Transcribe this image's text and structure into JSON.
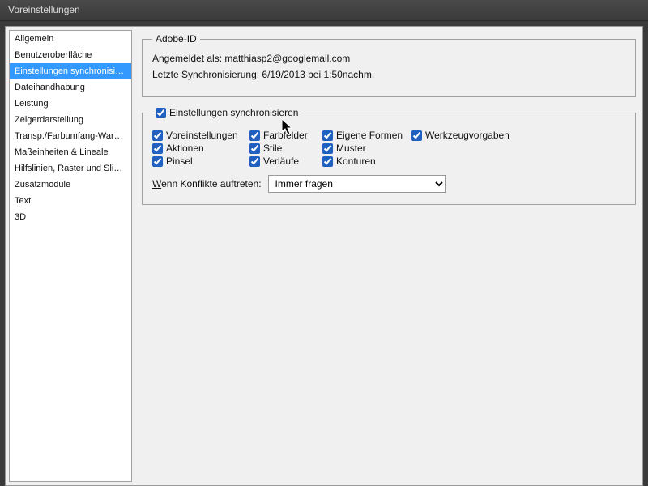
{
  "window": {
    "title": "Voreinstellungen"
  },
  "sidebar": {
    "items": [
      {
        "label": "Allgemein"
      },
      {
        "label": "Benutzeroberfläche"
      },
      {
        "label": "Einstellungen synchronisieren",
        "selected": true
      },
      {
        "label": "Dateihandhabung"
      },
      {
        "label": "Leistung"
      },
      {
        "label": "Zeigerdarstellung"
      },
      {
        "label": "Transp./Farbumfang-Warnung"
      },
      {
        "label": "Maßeinheiten & Lineale"
      },
      {
        "label": "Hilfslinien, Raster und Slices"
      },
      {
        "label": "Zusatzmodule"
      },
      {
        "label": "Text"
      },
      {
        "label": "3D"
      }
    ]
  },
  "adobe_id": {
    "legend": "Adobe-ID",
    "signed_in": "Angemeldet als: matthiasp2@googlemail.com",
    "last_sync": "Letzte Synchronisierung: 6/19/2013 bei 1:50nachm."
  },
  "sync": {
    "master": "Einstellungen synchronisieren",
    "options": {
      "preferences": "Voreinstellungen",
      "swatches": "Farbfelder",
      "shapes": "Eigene Formen",
      "tool_presets": "Werkzeugvorgaben",
      "actions": "Aktionen",
      "styles": "Stile",
      "patterns": "Muster",
      "brushes": "Pinsel",
      "gradients": "Verläufe",
      "contours": "Konturen"
    },
    "conflict_label_prefix": "W",
    "conflict_label_rest": "enn Konflikte auftreten:",
    "conflict_selected": "Immer fragen"
  }
}
